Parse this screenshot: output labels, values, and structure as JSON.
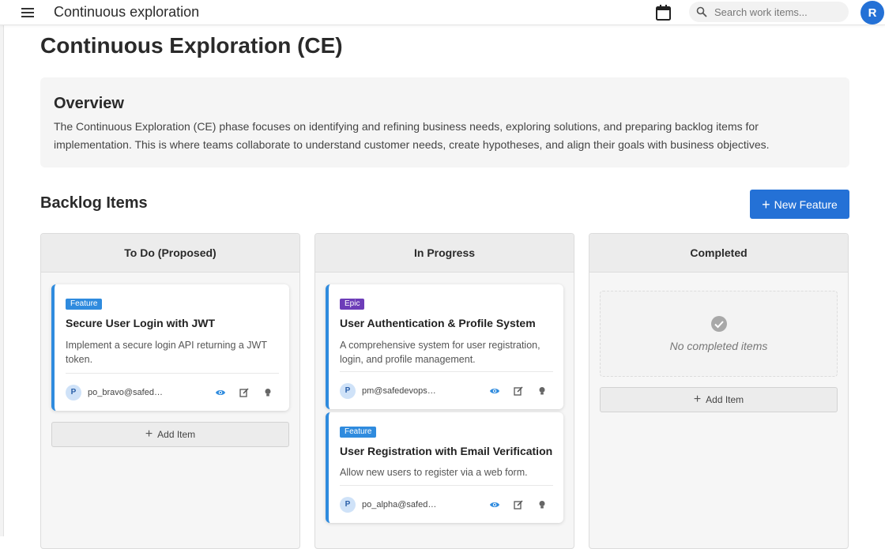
{
  "header": {
    "app_title": "Continuous exploration",
    "search_placeholder": "Search work items...",
    "avatar_initial": "R"
  },
  "page": {
    "title": "Continuous Exploration (CE)",
    "overview": {
      "heading": "Overview",
      "text": "The Continuous Exploration (CE) phase focuses on identifying and refining business needs, exploring solutions, and preparing backlog items for implementation. This is where teams collaborate to understand customer needs, create hypotheses, and align their goals with business objectives."
    },
    "backlog": {
      "title": "Backlog Items",
      "new_feature_label": "New Feature"
    }
  },
  "columns": [
    {
      "title": "To Do (Proposed)",
      "cards": [
        {
          "badge": "Feature",
          "title": "Secure User Login with JWT",
          "description": "Implement a secure login API returning a JWT token.",
          "user_initial": "P",
          "user_email": "po_bravo@safed…"
        }
      ],
      "add_label": "Add Item"
    },
    {
      "title": "In Progress",
      "cards": [
        {
          "badge": "Epic",
          "title": "User Authentication & Profile System",
          "description": "A comprehensive system for user registration, login, and profile management.",
          "user_initial": "P",
          "user_email": "pm@safedevops…"
        },
        {
          "badge": "Feature",
          "title": "User Registration with Email Verification",
          "description": "Allow new users to register via a web form.",
          "user_initial": "P",
          "user_email": "po_alpha@safed…"
        }
      ]
    },
    {
      "title": "Completed",
      "empty_text": "No completed items",
      "add_label": "Add Item"
    }
  ],
  "colors": {
    "primary": "#2471d6",
    "feature_badge": "#2f8bde",
    "epic_badge": "#6d3db8"
  }
}
